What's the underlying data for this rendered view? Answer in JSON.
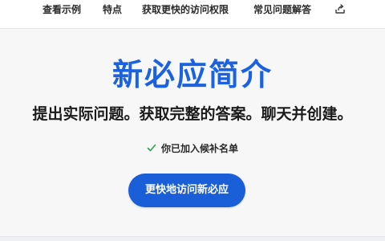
{
  "nav": {
    "items": [
      {
        "label": "查看示例"
      },
      {
        "label": "特点"
      },
      {
        "label": "获取更快的访问权限"
      },
      {
        "label": "常见问题解答"
      }
    ],
    "share_icon": "share-icon"
  },
  "hero": {
    "title": "新必应简介",
    "subtitle": "提出实际问题。获取完整的答案。聊天并创建。",
    "waitlist_status": "你已加入候补名单",
    "status_icon": "check-icon",
    "cta_label": "更快地访问新必应"
  },
  "colors": {
    "accent": "#1a62e0",
    "button": "#1a5ed8",
    "check": "#2e9e4f"
  }
}
